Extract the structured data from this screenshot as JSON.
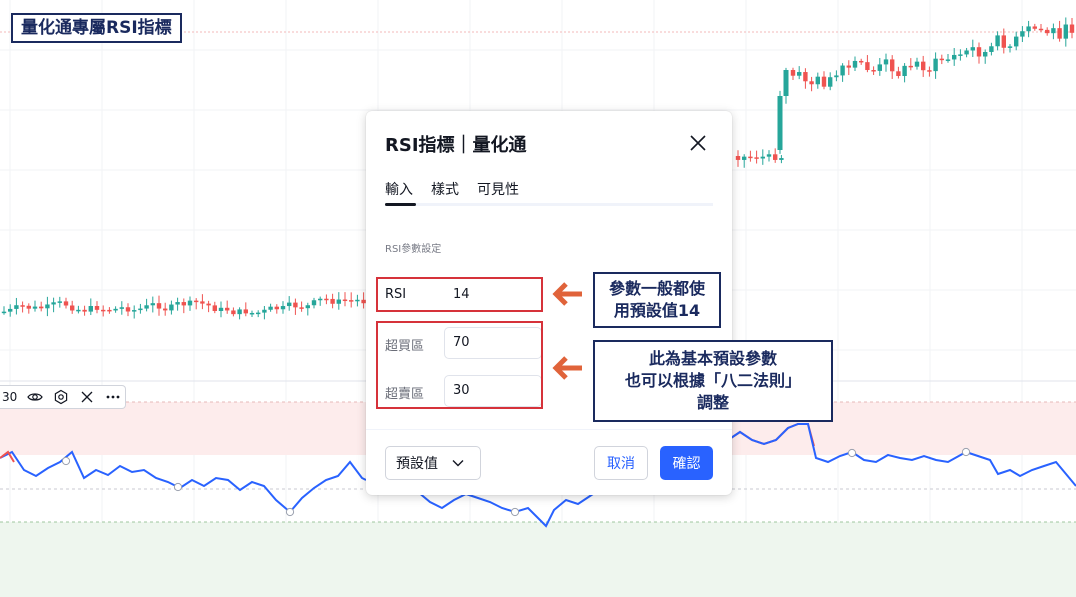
{
  "badge": {
    "title": "量化通專屬RSI指標"
  },
  "legend_bar": {
    "value": "30",
    "icons": [
      "eye-icon",
      "settings-icon",
      "close-icon",
      "more-icon"
    ]
  },
  "dialog": {
    "title": "RSI指標｜量化通",
    "tabs": [
      "輸入",
      "樣式",
      "可見性"
    ],
    "active_tab": 0,
    "section_label": "RSI參數設定",
    "fields": [
      {
        "label": "RSI",
        "value": "14"
      },
      {
        "label": "超買區",
        "value": "70"
      },
      {
        "label": "超賣區",
        "value": "30"
      }
    ],
    "defaults_label": "預設值",
    "cancel_label": "取消",
    "ok_label": "確認"
  },
  "callouts": {
    "first": [
      "參數一般都使",
      "用預設值14"
    ],
    "second": [
      "此為基本預設參數",
      "也可以根據「八二法則」",
      "調整"
    ]
  },
  "colors": {
    "up": "#26a69a",
    "down": "#ef5350",
    "rsi_line": "#2962ff",
    "overbought_zone": "#fdecec",
    "oversold_zone": "#eef6ee",
    "annotation_red": "#d6323a",
    "annotation_arrow": "#e0633a",
    "annotation_navy": "#1a2a5e",
    "accent": "#2962ff"
  },
  "rsi_settings": {
    "period": 14,
    "overbought": 70,
    "oversold": 30
  }
}
